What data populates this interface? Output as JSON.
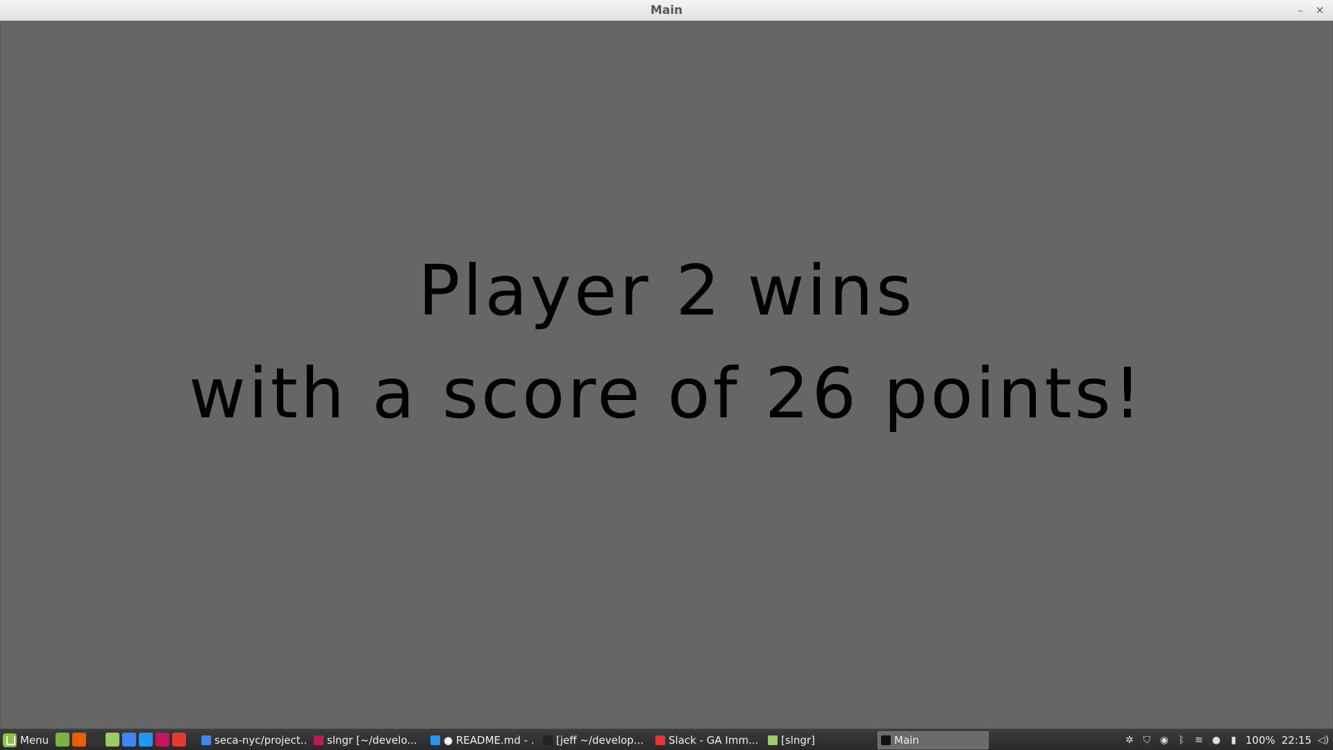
{
  "window": {
    "title": "Main",
    "minimize_glyph": "–",
    "close_glyph": "✕"
  },
  "game": {
    "line1": "Player 2 wins",
    "line2": "with a score of 26 points!",
    "background_color": "#666666",
    "text_color": "#000000"
  },
  "taskbar": {
    "menu_label": "Menu",
    "launchers": [
      {
        "name": "show-desktop-icon",
        "color": "#7cb342"
      },
      {
        "name": "firefox-icon",
        "color": "#e66000"
      },
      {
        "name": "terminal-icon",
        "color": "#333333"
      },
      {
        "name": "files-icon",
        "color": "#9ccc65"
      },
      {
        "name": "chrome-icon",
        "color": "#4285f4"
      },
      {
        "name": "vscode-icon",
        "color": "#2196f3"
      },
      {
        "name": "intellij-icon",
        "color": "#c2185b"
      },
      {
        "name": "slack-icon",
        "color": "#e53935"
      }
    ],
    "tasks": [
      {
        "label": "seca-nyc/project...",
        "icon": "chrome-icon",
        "color": "#4285f4"
      },
      {
        "label": "slngr [~/develo...",
        "icon": "intellij-icon",
        "color": "#c2185b"
      },
      {
        "label": "● README.md - ...",
        "icon": "vscode-icon",
        "color": "#2196f3"
      },
      {
        "label": "[jeff ~/develop...",
        "icon": "terminal-icon",
        "color": "#222222"
      },
      {
        "label": "Slack - GA Imm...",
        "icon": "slack-icon",
        "color": "#e53935"
      },
      {
        "label": "[slngr]",
        "icon": "folder-icon",
        "color": "#9ccc65"
      },
      {
        "label": "Main",
        "icon": "java-app-icon",
        "color": "#111111",
        "active": true
      }
    ],
    "tray": {
      "battery": "100%",
      "clock": "22:15"
    }
  }
}
